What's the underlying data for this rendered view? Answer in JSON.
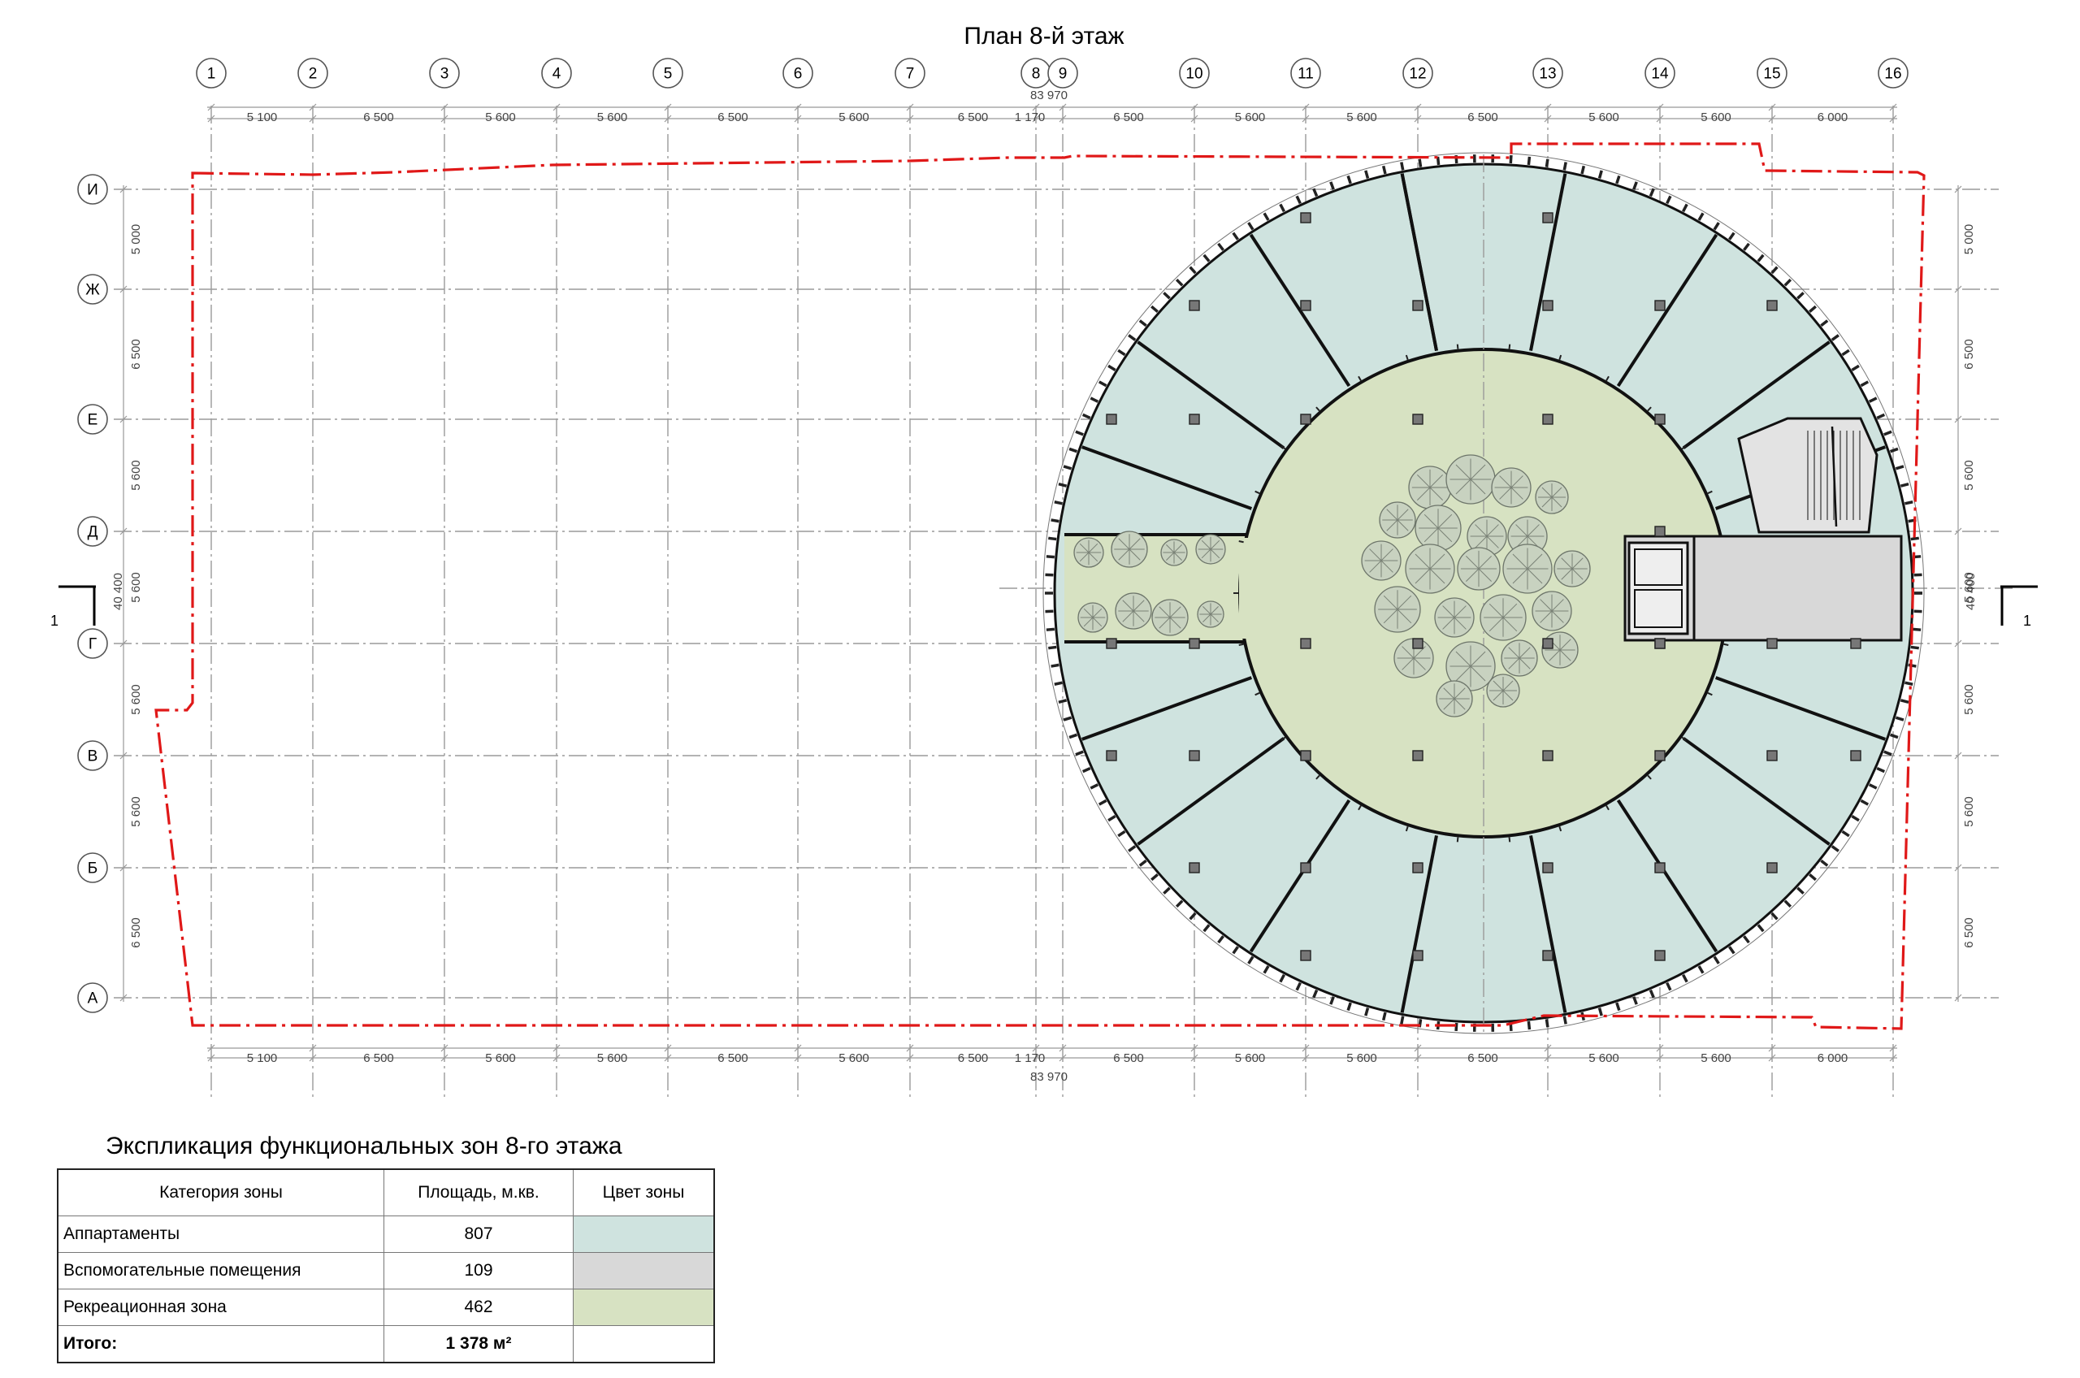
{
  "title": "План 8-й этаж",
  "columns": [
    "1",
    "2",
    "3",
    "4",
    "5",
    "6",
    "7",
    "8",
    "9",
    "10",
    "11",
    "12",
    "13",
    "14",
    "15",
    "16"
  ],
  "rows": [
    "И",
    "Ж",
    "Е",
    "Д",
    "Г",
    "В",
    "Б",
    "А"
  ],
  "column_spans": [
    "5 100",
    "6 500",
    "5 600",
    "5 600",
    "6 500",
    "5 600",
    "6 500",
    "1 170",
    "6 500",
    "5 600",
    "5 600",
    "6 500",
    "5 600",
    "5 600",
    "6 000"
  ],
  "total_width": "83 970",
  "row_spans": [
    "5 000",
    "6 500",
    "5 600",
    "5 600",
    "5 600",
    "5 600",
    "6 500"
  ],
  "total_height": "40 400",
  "section_label": "1",
  "legend": {
    "title": "Экспликация функциональных зон 8-го этажа",
    "headers": {
      "category": "Категория зоны",
      "area": "Площадь, м.кв.",
      "color": "Цвет зоны"
    },
    "rows": [
      {
        "category": "Аппартаменты",
        "area": "807",
        "color": "#cfe3df"
      },
      {
        "category": "Вспомогательные помещения",
        "area": "109",
        "color": "#d8d8d8"
      },
      {
        "category": "Рекреационная зона",
        "area": "462",
        "color": "#d7e2c2"
      }
    ],
    "total": {
      "label": "Итого:",
      "value": "1 378 м²"
    }
  },
  "colors": {
    "apartments": "#cfe3df",
    "auxiliary": "#d8d8d8",
    "recreation": "#d7e2c2",
    "boundary": "#e01818"
  }
}
